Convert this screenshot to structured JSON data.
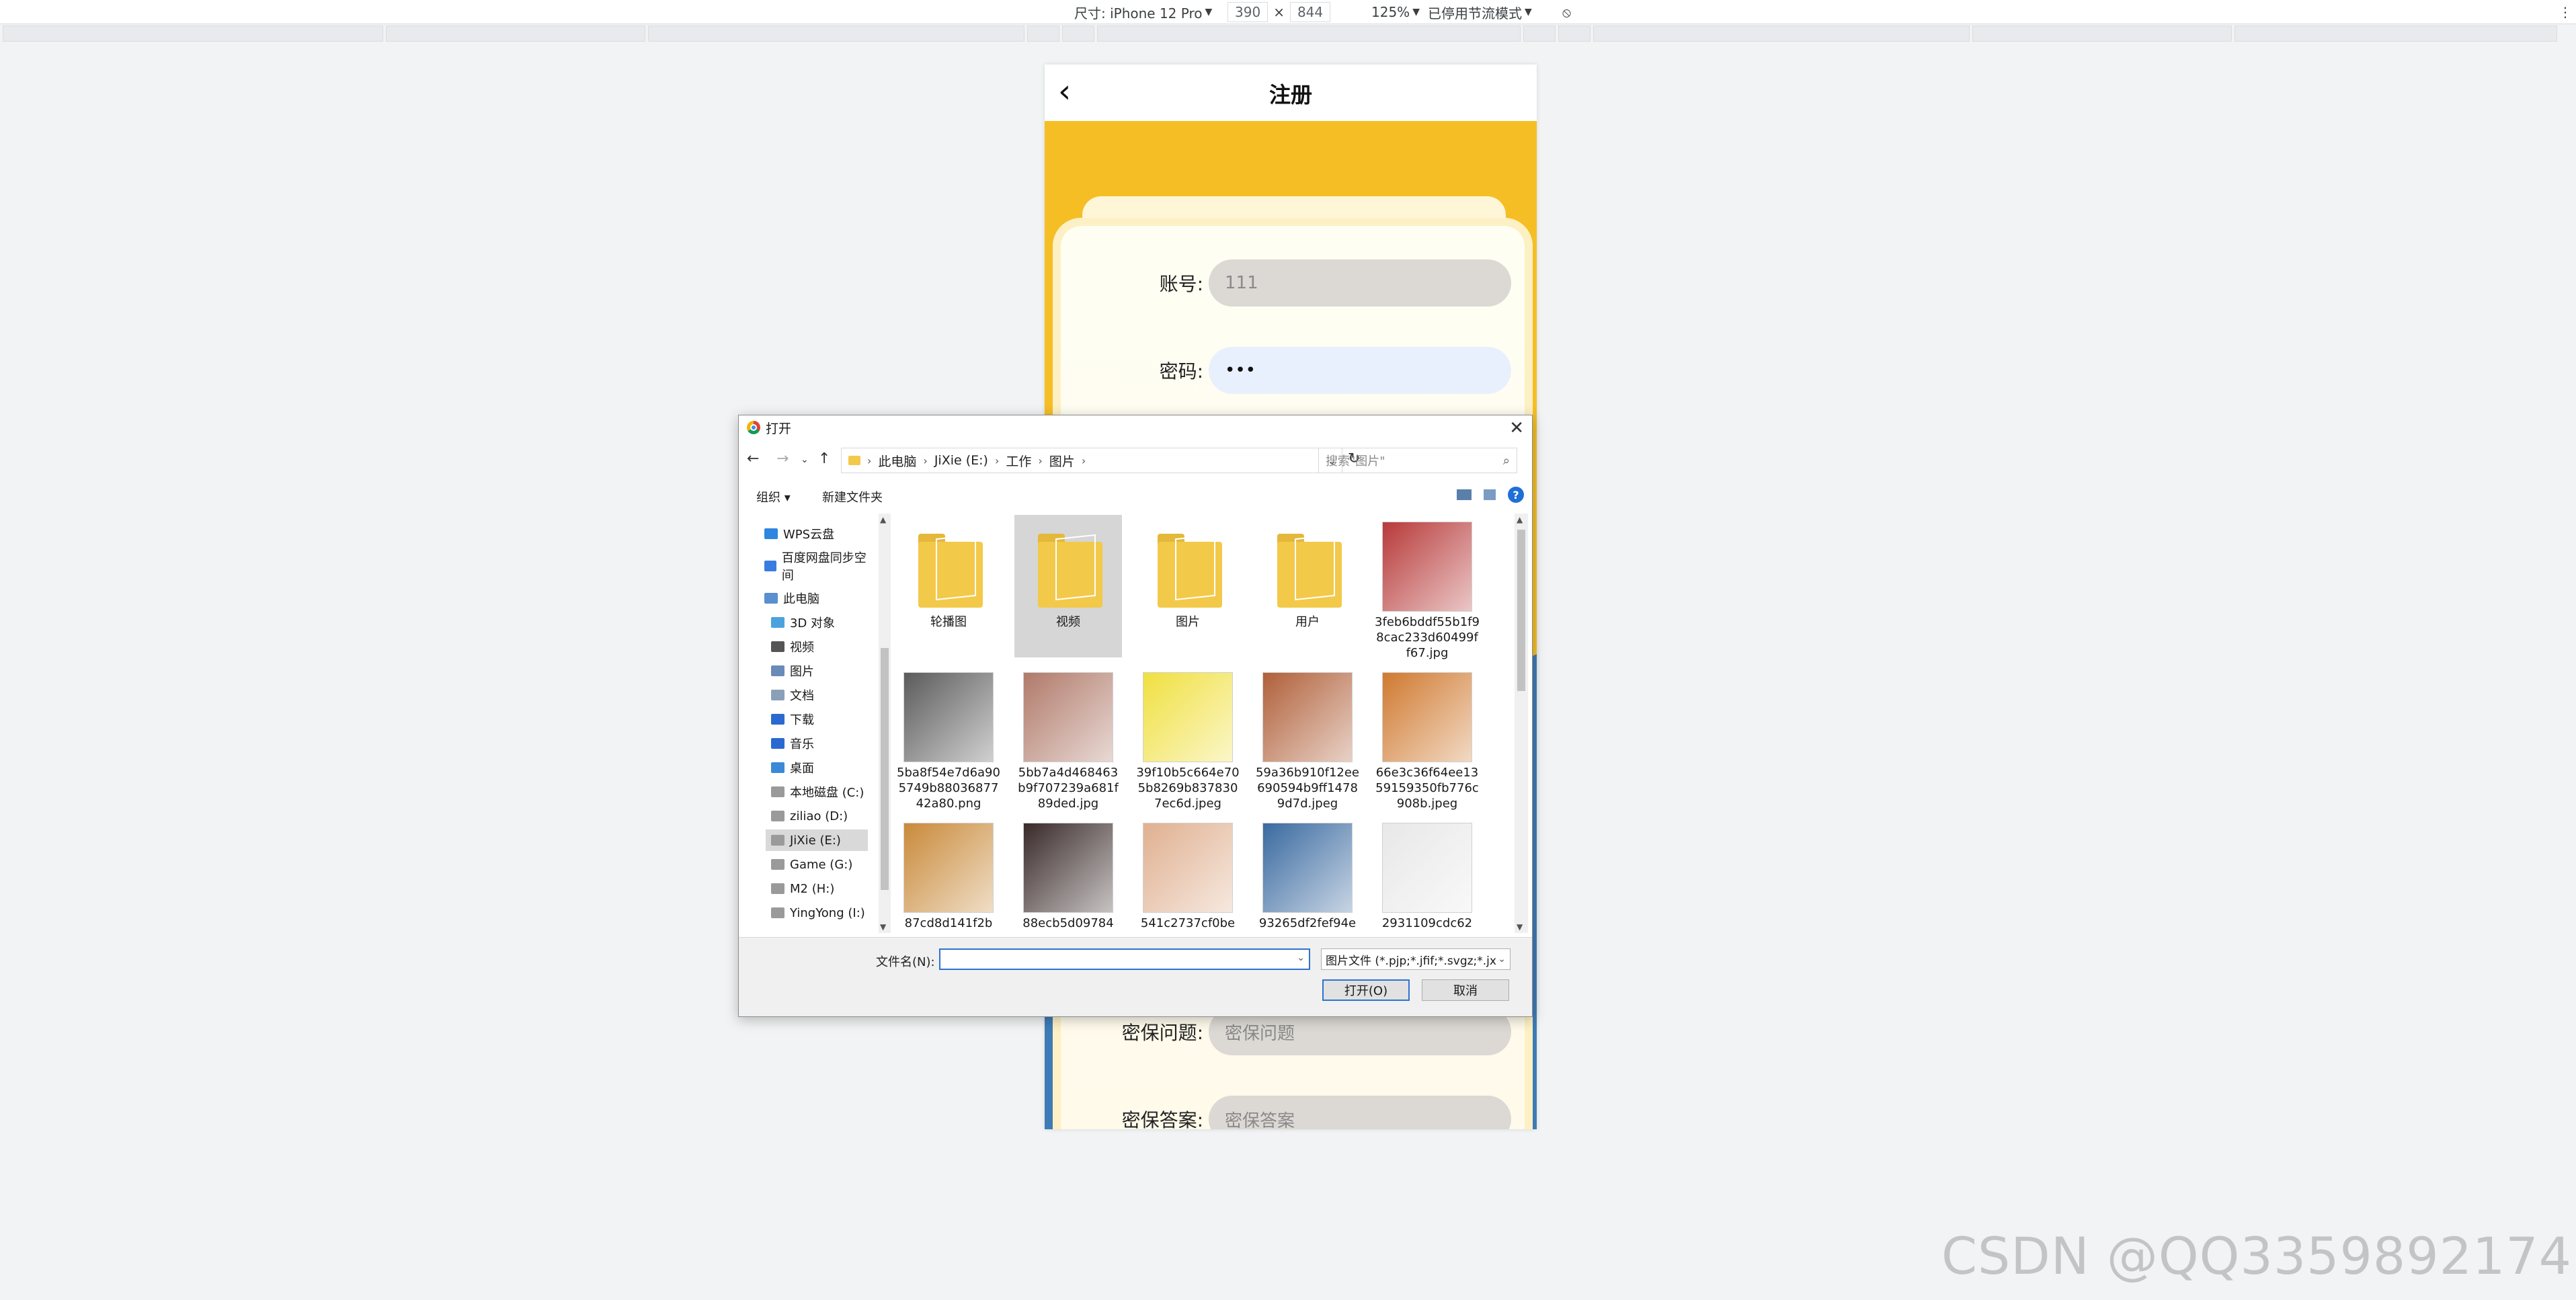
{
  "devtools": {
    "device_label": "尺寸: iPhone 12 Pro",
    "width": "390",
    "times": "×",
    "height": "844",
    "zoom": "125%",
    "throttle": "已停用节流模式"
  },
  "app": {
    "title": "注册",
    "back_icon": "‹",
    "fields": {
      "account_label": "账号:",
      "account_value": "111",
      "password_label": "密码:",
      "password_value": "•••",
      "question_label": "密保问题:",
      "question_placeholder": "密保问题",
      "answer_label": "密保答案:",
      "answer_placeholder": "密保答案"
    }
  },
  "dialog": {
    "title": "打开",
    "close": "✕",
    "breadcrumb": [
      "此电脑",
      "JiXie (E:)",
      "工作",
      "图片"
    ],
    "search_placeholder": "搜索\"图片\"",
    "toolbar": {
      "organize": "组织 ▾",
      "new_folder": "新建文件夹"
    },
    "nav_items": [
      {
        "label": "WPS云盘",
        "icon": "cloud-icon"
      },
      {
        "label": "百度网盘同步空间",
        "icon": "baidu-icon"
      },
      {
        "label": "此电脑",
        "icon": "computer-icon"
      },
      {
        "label": "3D 对象",
        "icon": "3d-objects-icon"
      },
      {
        "label": "视频",
        "icon": "video-icon"
      },
      {
        "label": "图片",
        "icon": "pictures-icon"
      },
      {
        "label": "文档",
        "icon": "documents-icon"
      },
      {
        "label": "下载",
        "icon": "download-icon"
      },
      {
        "label": "音乐",
        "icon": "music-icon"
      },
      {
        "label": "桌面",
        "icon": "desktop-icon"
      },
      {
        "label": "本地磁盘 (C:)",
        "icon": "drive-icon"
      },
      {
        "label": "ziliao (D:)",
        "icon": "drive-icon"
      },
      {
        "label": "JiXie (E:)",
        "icon": "drive-icon"
      },
      {
        "label": "Game (G:)",
        "icon": "drive-icon"
      },
      {
        "label": "M2 (H:)",
        "icon": "drive-icon"
      },
      {
        "label": "YingYong (I:)",
        "icon": "drive-icon"
      }
    ],
    "files": [
      {
        "name": "轮播图",
        "kind": "folder"
      },
      {
        "name": "视频",
        "kind": "folder",
        "selected": true
      },
      {
        "name": "图片",
        "kind": "folder"
      },
      {
        "name": "用户",
        "kind": "folder"
      },
      {
        "name": "3feb6bddf55b1f98cac233d60499ff67.jpg",
        "kind": "image",
        "color": "#b83a3a"
      },
      {
        "name": "5ba8f54e7d6a905749b8803687742a80.png",
        "kind": "image",
        "color": "#5b5b5b"
      },
      {
        "name": "5bb7a4d468463b9f707239a681f89ded.jpg",
        "kind": "image",
        "color": "#b07a6a"
      },
      {
        "name": "39f10b5c664e705b8269b8378307ec6d.jpeg",
        "kind": "image",
        "color": "#f0e040"
      },
      {
        "name": "59a36b910f12ee690594b9ff14789d7d.jpeg",
        "kind": "image",
        "color": "#b0603a"
      },
      {
        "name": "66e3c36f64ee1359159350fb776c908b.jpeg",
        "kind": "image",
        "color": "#d07a30"
      },
      {
        "name": "87cd8d141f2b",
        "kind": "image",
        "color": "#c98a3a"
      },
      {
        "name": "88ecb5d09784",
        "kind": "image",
        "color": "#3a2a2a"
      },
      {
        "name": "541c2737cf0be",
        "kind": "image",
        "color": "#e0b090"
      },
      {
        "name": "93265df2fef94e",
        "kind": "image",
        "color": "#3a6aa0"
      },
      {
        "name": "2931109cdc62",
        "kind": "image",
        "color": "#e8e8e8"
      }
    ],
    "filename_label": "文件名(N):",
    "filename_value": "",
    "filter_value": "图片文件 (*.pjp;*.jfif;*.svgz;*.jx",
    "open_button": "打开(O)",
    "cancel_button": "取消"
  },
  "watermark": "CSDN @QQ3359892174"
}
